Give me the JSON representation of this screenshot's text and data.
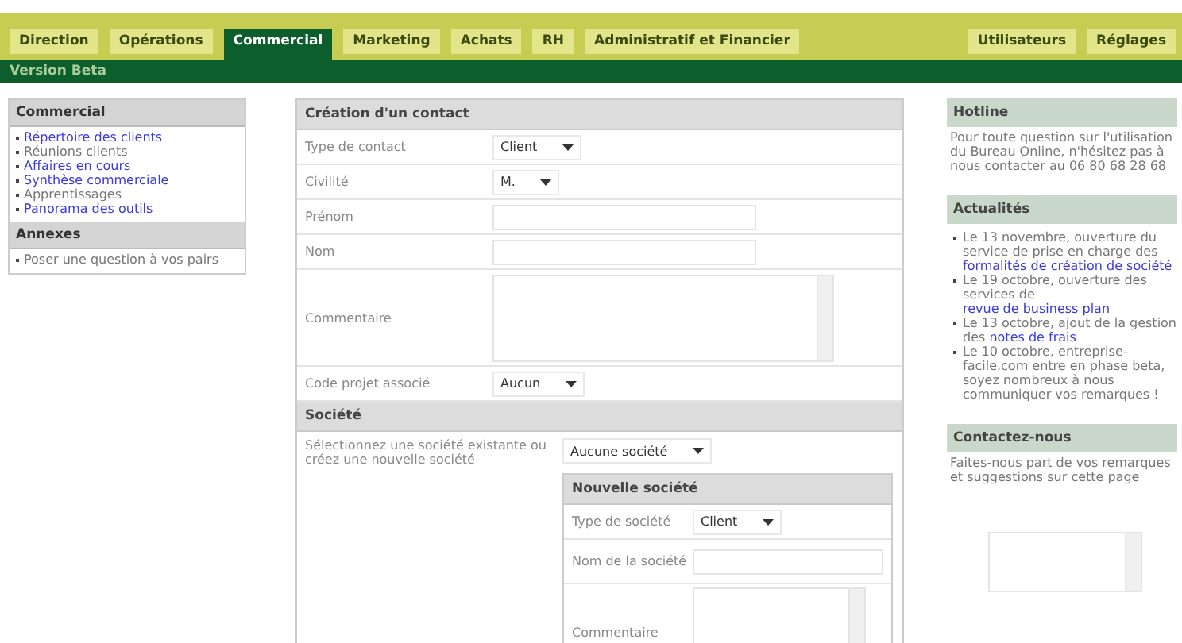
{
  "tabs": [
    {
      "label": "Direction",
      "selected": false
    },
    {
      "label": "Opérations",
      "selected": false
    },
    {
      "label": "Commercial",
      "selected": true
    },
    {
      "label": "Marketing",
      "selected": false
    },
    {
      "label": "Achats",
      "selected": false
    },
    {
      "label": "RH",
      "selected": false
    },
    {
      "label": "Administratif et Financier",
      "selected": false
    }
  ],
  "right_tabs": [
    {
      "label": "Utilisateurs",
      "selected": false
    },
    {
      "label": "Réglages",
      "selected": false
    }
  ],
  "version": "Version Beta",
  "sidebar": [
    {
      "title": "Commercial",
      "items": [
        {
          "label": "Répertoire des clients",
          "link": true
        },
        {
          "label": "Réunions clients",
          "link": false
        },
        {
          "label": "Affaires en cours",
          "link": true
        },
        {
          "label": "Synthèse commerciale",
          "link": true
        },
        {
          "label": "Apprentissages",
          "link": false
        },
        {
          "label": "Panorama des outils",
          "link": true
        }
      ]
    },
    {
      "title": "Annexes",
      "items": [
        {
          "label": "Poser une question à vos pairs",
          "link": false
        }
      ]
    }
  ],
  "contact_form": {
    "title": "Création d'un contact",
    "rows": [
      {
        "kind": "select",
        "label": "Type de contact",
        "value": "Client"
      },
      {
        "kind": "select",
        "label": "Civilité",
        "value": "M."
      },
      {
        "kind": "input",
        "label": "Prénom"
      },
      {
        "kind": "input",
        "label": "Nom"
      },
      {
        "kind": "textarea",
        "label": "Commentaire"
      },
      {
        "kind": "select",
        "label": "Code projet associé",
        "value": "Aucun"
      }
    ]
  },
  "company": {
    "title": "Société",
    "hint": "Sélectionnez une société existante ou créez une nouvelle société",
    "select": "Aucune société",
    "new_company": {
      "title": "Nouvelle société",
      "rows": [
        {
          "kind": "select",
          "label": "Type de société",
          "value": "Client"
        },
        {
          "kind": "input",
          "label": "Nom de la société"
        },
        {
          "kind": "textarea",
          "label": "Commentaire"
        }
      ]
    }
  },
  "hotline": {
    "title": "Hotline",
    "text": "Pour toute question sur l'utilisation du Bureau Online, n'hésitez pas à nous contacter au 06 80 68 28 68"
  },
  "news": {
    "title": "Actualités",
    "items": [
      {
        "before": "Le 13 novembre, ouverture du service de prise en charge des ",
        "link": "formalités de création de société"
      },
      {
        "before": "Le 19 octobre, ouverture des services de ",
        "link": "revue de business plan"
      },
      {
        "before": "Le 13 octobre, ajout de la gestion des ",
        "link": "notes de frais"
      },
      {
        "before": "Le 10 octobre, entreprise-facile.com entre en phase beta, soyez nombreux à nous communiquer vos remarques !"
      }
    ]
  },
  "contact": {
    "title": "Contactez-nous",
    "text": "Faites-nous part de vos remarques et suggestions sur cette page"
  }
}
